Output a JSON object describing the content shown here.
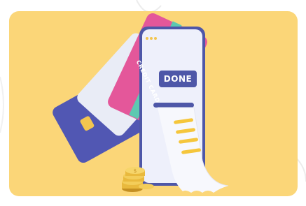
{
  "illustration": {
    "button_label": "DONE",
    "card_text": "CREDIT CARD",
    "colors": {
      "background": "#fbd678",
      "phone": "#eef0fb",
      "accent_blue": "#4e57a8",
      "card_pink": "#e4579a",
      "card_stripe": "#5dc9b1",
      "receipt_lines": "#f5c63c",
      "coin": "#e9b93d"
    }
  }
}
